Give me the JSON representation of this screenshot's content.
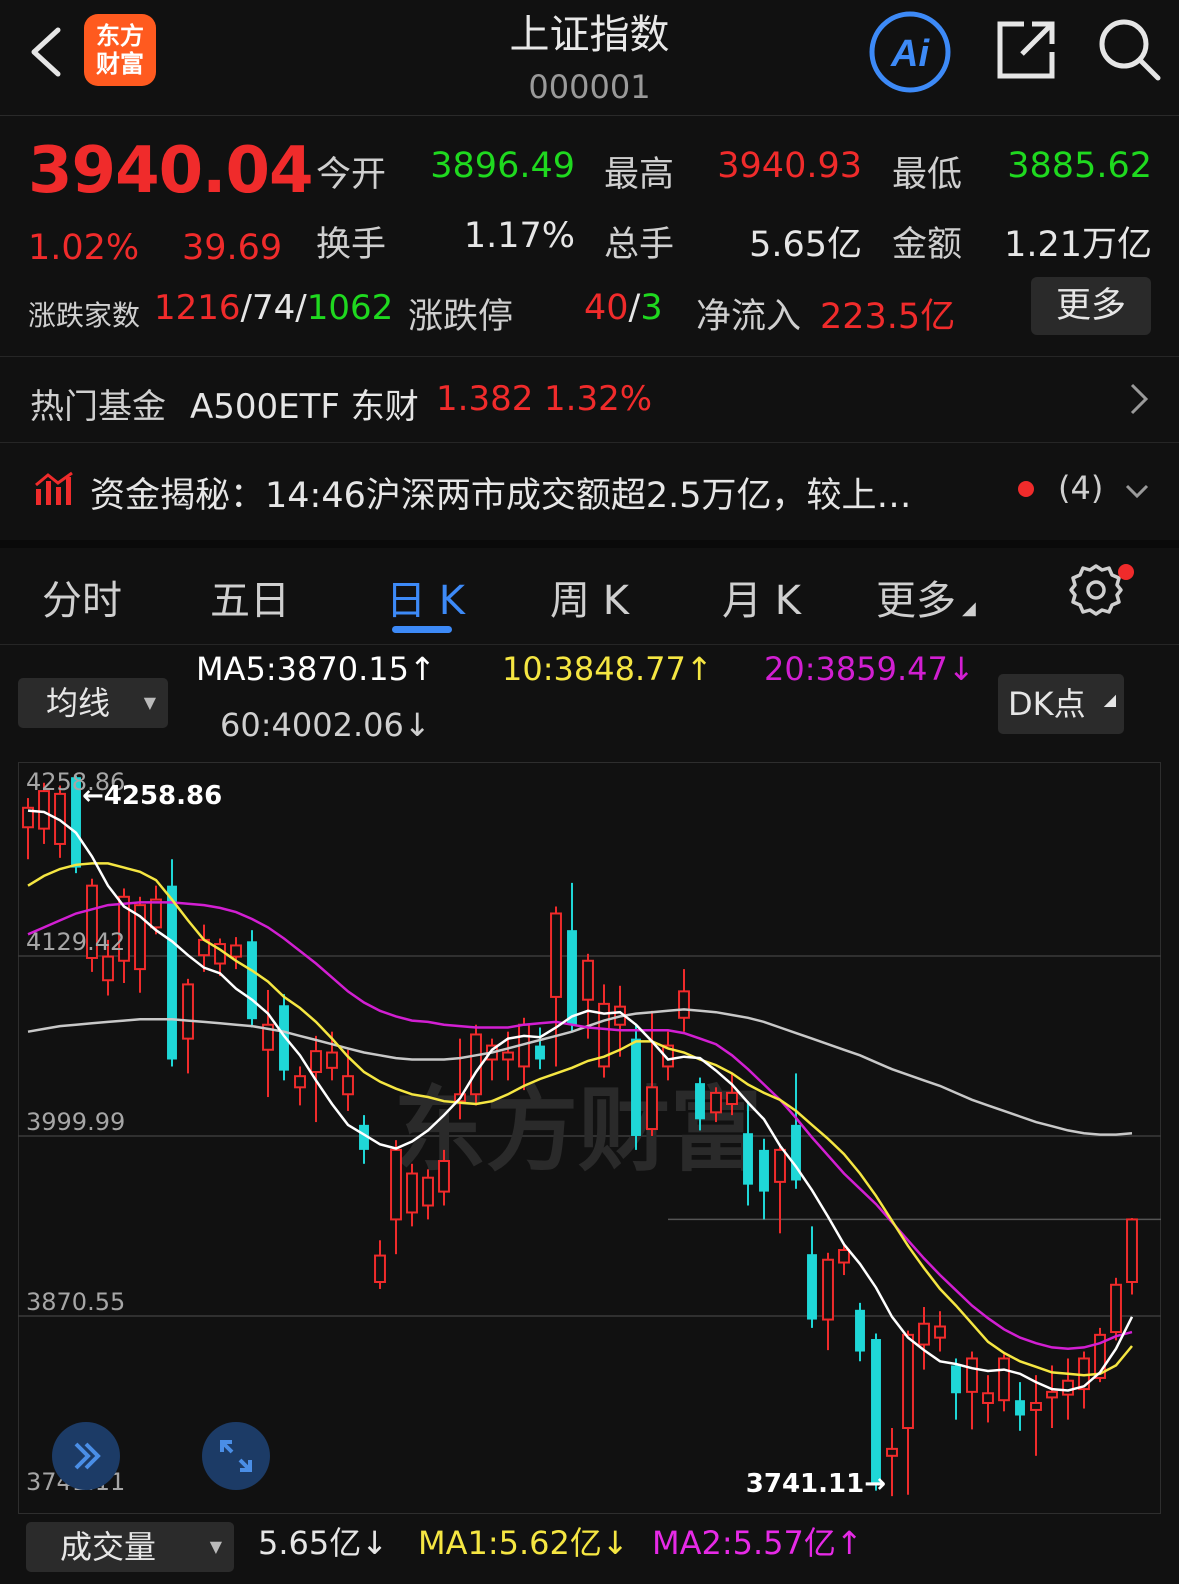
{
  "header": {
    "title": "上证指数",
    "code": "000001",
    "logo_text_line1": "东方",
    "logo_text_line2": "财富",
    "ai_label": "Ai"
  },
  "quote": {
    "price": "3940.04",
    "change_pct": "1.02%",
    "change_abs": "39.69",
    "open_label": "今开",
    "open_value": "3896.49",
    "high_label": "最高",
    "high_value": "3940.93",
    "low_label": "最低",
    "low_value": "3885.62",
    "turnover_label": "换手",
    "turnover_value": "1.17%",
    "volume_label": "总手",
    "volume_value": "5.65亿",
    "amount_label": "金额",
    "amount_value": "1.21万亿",
    "breadth_label": "涨跌家数",
    "breadth_up": "1216",
    "sep1": "/",
    "breadth_flat": "74",
    "sep2": "/",
    "breadth_down": "1062",
    "limit_label": "涨跌停",
    "limit_up": "40",
    "limit_sep": "/",
    "limit_down": "3",
    "netflow_label": "净流入",
    "netflow_value": "223.5亿",
    "more_label": "更多"
  },
  "fund": {
    "label": "热门基金",
    "name": "A500ETF 东财",
    "price": "1.382",
    "change": "1.32%"
  },
  "news": {
    "text": "资金揭秘：14:46沪深两市成交额超2.5万亿，较上…",
    "count": "(4)"
  },
  "tabs": [
    {
      "label": "分时"
    },
    {
      "label": "五日"
    },
    {
      "label": "日 K"
    },
    {
      "label": "周 K"
    },
    {
      "label": "月 K"
    },
    {
      "label": "更多"
    }
  ],
  "ma_legend": {
    "selector": "均线",
    "ma5": "MA5:3870.15↑",
    "ma10": "10:3848.77↑",
    "ma20": "20:3859.47↓",
    "ma60": "60:4002.06↓",
    "dk": "DK点"
  },
  "colors": {
    "up": "#f02b2b",
    "down": "#1fd7d7",
    "ma5": "#ffffff",
    "ma10": "#f5e642",
    "ma20": "#d21fd2",
    "ma60": "#c8c8c8",
    "accent": "#3d8af7"
  },
  "chart_data": {
    "type": "candlestick",
    "y_ticks": [
      "4258.86",
      "4129.42",
      "3999.99",
      "3870.55",
      "3741.11"
    ],
    "y_range": [
      3741.11,
      4258.86
    ],
    "max_label": "←4258.86",
    "min_label": "3741.11→",
    "candles": [
      {
        "o": 4222,
        "c": 4236,
        "h": 4243,
        "l": 4199
      },
      {
        "o": 4221,
        "c": 4248,
        "h": 4254,
        "l": 4210
      },
      {
        "o": 4210,
        "c": 4246,
        "h": 4252,
        "l": 4200
      },
      {
        "o": 4258,
        "c": 4193,
        "h": 4259,
        "l": 4189
      },
      {
        "o": 4128,
        "c": 4180,
        "h": 4185,
        "l": 4118
      },
      {
        "o": 4112,
        "c": 4129,
        "h": 4141,
        "l": 4101
      },
      {
        "o": 4126,
        "c": 4172,
        "h": 4178,
        "l": 4110
      },
      {
        "o": 4120,
        "c": 4166,
        "h": 4172,
        "l": 4103
      },
      {
        "o": 4150,
        "c": 4170,
        "h": 4180,
        "l": 4145
      },
      {
        "o": 4180,
        "c": 4055,
        "h": 4199,
        "l": 4050
      },
      {
        "o": 4070,
        "c": 4109,
        "h": 4113,
        "l": 4045
      },
      {
        "o": 4130,
        "c": 4141,
        "h": 4152,
        "l": 4118
      },
      {
        "o": 4124,
        "c": 4138,
        "h": 4142,
        "l": 4115
      },
      {
        "o": 4129,
        "c": 4137,
        "h": 4143,
        "l": 4120
      },
      {
        "o": 4140,
        "c": 4084,
        "h": 4148,
        "l": 4078
      },
      {
        "o": 4062,
        "c": 4080,
        "h": 4105,
        "l": 4028
      },
      {
        "o": 4094,
        "c": 4047,
        "h": 4102,
        "l": 4040
      },
      {
        "o": 4035,
        "c": 4043,
        "h": 4050,
        "l": 4022
      },
      {
        "o": 4046,
        "c": 4061,
        "h": 4072,
        "l": 4010
      },
      {
        "o": 4049,
        "c": 4060,
        "h": 4075,
        "l": 4040
      },
      {
        "o": 4030,
        "c": 4043,
        "h": 4062,
        "l": 4018
      },
      {
        "o": 4008,
        "c": 3990,
        "h": 4015,
        "l": 3980
      },
      {
        "o": 3895,
        "c": 3914,
        "h": 3925,
        "l": 3890
      },
      {
        "o": 3940,
        "c": 3990,
        "h": 3997,
        "l": 3915
      },
      {
        "o": 3945,
        "c": 3973,
        "h": 3980,
        "l": 3935
      },
      {
        "o": 3950,
        "c": 3970,
        "h": 3976,
        "l": 3940
      },
      {
        "o": 3960,
        "c": 3982,
        "h": 3990,
        "l": 3950
      },
      {
        "o": 4025,
        "c": 4030,
        "h": 4070,
        "l": 4012
      },
      {
        "o": 4030,
        "c": 4073,
        "h": 4080,
        "l": 4022
      },
      {
        "o": 4055,
        "c": 4065,
        "h": 4070,
        "l": 4040
      },
      {
        "o": 4055,
        "c": 4060,
        "h": 4075,
        "l": 4040
      },
      {
        "o": 4050,
        "c": 4080,
        "h": 4085,
        "l": 4033
      },
      {
        "o": 4065,
        "c": 4055,
        "h": 4078,
        "l": 4048
      },
      {
        "o": 4100,
        "c": 4160,
        "h": 4165,
        "l": 4050
      },
      {
        "o": 4148,
        "c": 4080,
        "h": 4182,
        "l": 4075
      },
      {
        "o": 4098,
        "c": 4126,
        "h": 4131,
        "l": 4070
      },
      {
        "o": 4050,
        "c": 4095,
        "h": 4109,
        "l": 4042
      },
      {
        "o": 4080,
        "c": 4093,
        "h": 4108,
        "l": 4057
      },
      {
        "o": 4070,
        "c": 4000,
        "h": 4080,
        "l": 3990
      },
      {
        "o": 4005,
        "c": 4035,
        "h": 4090,
        "l": 4000
      },
      {
        "o": 4050,
        "c": 4065,
        "h": 4075,
        "l": 4040
      },
      {
        "o": 4085,
        "c": 4104,
        "h": 4120,
        "l": 4075
      },
      {
        "o": 4038,
        "c": 4012,
        "h": 4042,
        "l": 4004
      },
      {
        "o": 4017,
        "c": 4031,
        "h": 4035,
        "l": 4010
      },
      {
        "o": 4023,
        "c": 4031,
        "h": 4045,
        "l": 4015
      },
      {
        "o": 4002,
        "c": 3965,
        "h": 4025,
        "l": 3950
      },
      {
        "o": 3990,
        "c": 3960,
        "h": 3998,
        "l": 3940
      },
      {
        "o": 3967,
        "c": 3990,
        "h": 3994,
        "l": 3930
      },
      {
        "o": 4008,
        "c": 3968,
        "h": 4045,
        "l": 3962
      },
      {
        "o": 3915,
        "c": 3868,
        "h": 3935,
        "l": 3862
      },
      {
        "o": 3868,
        "c": 3911,
        "h": 3916,
        "l": 3846
      },
      {
        "o": 3909,
        "c": 3918,
        "h": 3922,
        "l": 3900
      },
      {
        "o": 3875,
        "c": 3845,
        "h": 3880,
        "l": 3838
      },
      {
        "o": 3854,
        "c": 3749,
        "h": 3858,
        "l": 3745
      },
      {
        "o": 3770,
        "c": 3775,
        "h": 3790,
        "l": 3741
      },
      {
        "o": 3790,
        "c": 3857,
        "h": 3860,
        "l": 3742
      },
      {
        "o": 3850,
        "c": 3865,
        "h": 3877,
        "l": 3832
      },
      {
        "o": 3855,
        "c": 3863,
        "h": 3874,
        "l": 3845
      },
      {
        "o": 3835,
        "c": 3815,
        "h": 3840,
        "l": 3796
      },
      {
        "o": 3816,
        "c": 3840,
        "h": 3845,
        "l": 3789
      },
      {
        "o": 3808,
        "c": 3815,
        "h": 3828,
        "l": 3794
      },
      {
        "o": 3810,
        "c": 3840,
        "h": 3843,
        "l": 3802
      },
      {
        "o": 3810,
        "c": 3799,
        "h": 3823,
        "l": 3788
      },
      {
        "o": 3803,
        "c": 3808,
        "h": 3828,
        "l": 3770
      },
      {
        "o": 3812,
        "c": 3816,
        "h": 3835,
        "l": 3790
      },
      {
        "o": 3814,
        "c": 3824,
        "h": 3840,
        "l": 3796
      },
      {
        "o": 3818,
        "c": 3840,
        "h": 3845,
        "l": 3804
      },
      {
        "o": 3826,
        "c": 3857,
        "h": 3862,
        "l": 3823
      },
      {
        "o": 3859,
        "c": 3893,
        "h": 3898,
        "l": 3853
      },
      {
        "o": 3895,
        "c": 3940,
        "h": 3941,
        "l": 3886
      }
    ],
    "ma5": [
      4234,
      4233,
      4227,
      4218,
      4201,
      4180,
      4165,
      4158,
      4148,
      4140,
      4130,
      4121,
      4117,
      4106,
      4098,
      4088,
      4072,
      4058,
      4040,
      4023,
      4008,
      4001,
      3994,
      3991,
      3996,
      4004,
      4015,
      4027,
      4046,
      4062,
      4070,
      4072,
      4071,
      4078,
      4086,
      4090,
      4088,
      4089,
      4080,
      4068,
      4055,
      4057,
      4056,
      4047,
      4037,
      4024,
      4012,
      3993,
      3978,
      3961,
      3942,
      3922,
      3908,
      3891,
      3870,
      3855,
      3846,
      3838,
      3836,
      3833,
      3831,
      3832,
      3829,
      3823,
      3818,
      3817,
      3820,
      3830,
      3847,
      3870
    ],
    "ma10": [
      4180,
      4187,
      4192,
      4195,
      4196,
      4196,
      4193,
      4190,
      4184,
      4170,
      4155,
      4141,
      4134,
      4126,
      4119,
      4111,
      4100,
      4092,
      4082,
      4070,
      4057,
      4046,
      4039,
      4034,
      4030,
      4028,
      4025,
      4024,
      4023,
      4025,
      4030,
      4036,
      4041,
      4045,
      4049,
      4054,
      4057,
      4062,
      4068,
      4068,
      4063,
      4060,
      4055,
      4051,
      4045,
      4037,
      4031,
      4026,
      4018,
      4008,
      3998,
      3987,
      3973,
      3957,
      3939,
      3921,
      3905,
      3890,
      3878,
      3865,
      3852,
      3844,
      3838,
      3834,
      3830,
      3829,
      3828,
      3829,
      3835,
      3849
    ],
    "ma20": [
      4145,
      4150,
      4155,
      4160,
      4163,
      4166,
      4167,
      4168,
      4168,
      4168,
      4167,
      4166,
      4164,
      4161,
      4156,
      4150,
      4142,
      4133,
      4124,
      4114,
      4104,
      4096,
      4090,
      4086,
      4083,
      4082,
      4080,
      4079,
      4078,
      4078,
      4078,
      4080,
      4081,
      4082,
      4080,
      4078,
      4077,
      4076,
      4076,
      4076,
      4076,
      4074,
      4070,
      4066,
      4058,
      4048,
      4037,
      4026,
      4013,
      3999,
      3986,
      3973,
      3962,
      3951,
      3938,
      3925,
      3912,
      3900,
      3889,
      3878,
      3869,
      3861,
      3855,
      3851,
      3848,
      3847,
      3848,
      3851,
      3856,
      3859
    ],
    "ma60": [
      4075,
      4077,
      4079,
      4080,
      4081,
      4082,
      4083,
      4084,
      4084,
      4084,
      4083,
      4082,
      4081,
      4080,
      4079,
      4077,
      4075,
      4072,
      4069,
      4066,
      4063,
      4060,
      4058,
      4056,
      4055,
      4055,
      4055,
      4056,
      4058,
      4060,
      4063,
      4066,
      4069,
      4072,
      4075,
      4079,
      4083,
      4086,
      4088,
      4089,
      4090,
      4091,
      4090,
      4089,
      4087,
      4085,
      4082,
      4078,
      4074,
      4070,
      4066,
      4062,
      4058,
      4053,
      4048,
      4044,
      4040,
      4036,
      4031,
      4026,
      4022,
      4018,
      4014,
      4010,
      4007,
      4004,
      4002,
      4001,
      4001,
      4002
    ]
  },
  "volume_bar": {
    "selector": "成交量",
    "volume": "5.65亿↓",
    "ma1": "MA1:5.62亿↓",
    "ma2": "MA2:5.57亿↑"
  },
  "watermark": "东方财富"
}
